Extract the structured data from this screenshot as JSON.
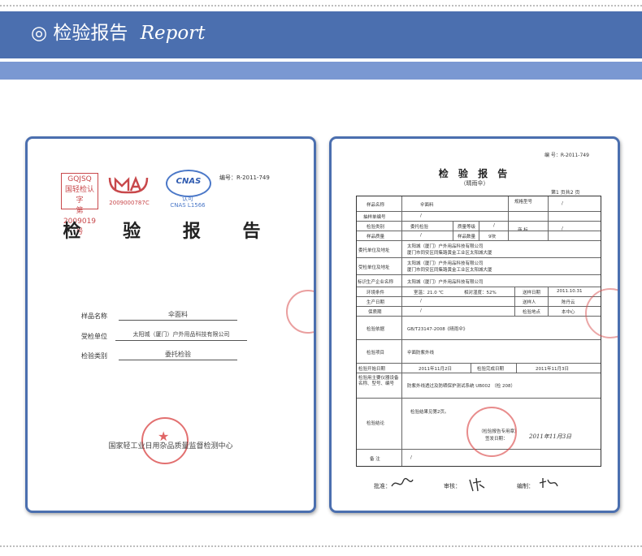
{
  "header": {
    "title": "检验报告",
    "title_script": "Report",
    "bullet_icon": "◎"
  },
  "cover": {
    "logo_gqjsq_top": "GQJSQ",
    "logo_gqjsq_mid": "国轻检认字",
    "logo_gqjsq_num": "第2009019号",
    "logo_ma_code": "2009000787C",
    "logo_cnas_label": "CNAS",
    "logo_cnas_cn": "认可",
    "logo_cnas_code": "CNAS L1566",
    "report_no_label": "编号：",
    "report_no": "R-2011-749",
    "title_left": "检 验",
    "title_right": "报 告",
    "fields": [
      {
        "label": "样品名称",
        "value": "伞面料"
      },
      {
        "label": "受检单位",
        "value": "太阳城（厦门）户外用品科技有限公司"
      },
      {
        "label": "检验类别",
        "value": "委托检验"
      }
    ],
    "org": "国家轻工业日用杂品质量监督检测中心"
  },
  "report": {
    "report_no_label": "编 号：",
    "report_no": "R-2011-749",
    "title": "检 验 报 告",
    "subtitle": "（晴雨伞）",
    "page": "第1 页共2 页",
    "rows": {
      "sample_name_label": "样品名称",
      "sample_name": "伞面料",
      "sample_no_label": "抽样单编号",
      "sample_no": "/",
      "model_label": "规格型号",
      "model": "/",
      "category_label": "检验类别",
      "category": "委托检验",
      "grade_label": "质量等级",
      "grade": "/",
      "brand_label": "商 标",
      "brand": "/",
      "qty_label": "样品数量",
      "qty": "9块",
      "quality_label": "样品质量",
      "quality": "/",
      "client_label": "委托单位及地址",
      "client": "太阳城（厦门）户外用品科技有限公司",
      "client_addr": "厦门市同安区同集路黄金工业区太阳城大厦",
      "inspected_label": "受检单位及地址",
      "inspected": "太阳城（厦门）户外用品科技有限公司",
      "inspected_addr": "厦门市同安区同集路黄金工业区太阳城大厦",
      "producer_label": "标识生产企业名称",
      "producer": "太阳城（厦门）户外用品科技有限公司",
      "env_label": "环境条件",
      "env_temp": "室温：21.0 ℃",
      "env_humidity": "相对湿度：52%",
      "send_date_label": "送样日期",
      "send_date": "2011.10.31",
      "prod_date_label": "生产日期",
      "prod_date": "/",
      "sender_label": "送样人",
      "sender": "陈丹云",
      "expire_label": "保质期",
      "expire": "/",
      "location_label": "检验地点",
      "location": "本中心",
      "basis_label": "检验依据",
      "basis": "GB/T23147-2008《晴雨伞》",
      "items_label": "检验项目",
      "items": "伞面防紫外线",
      "start_label": "检验开始日期",
      "start": "2011年11月2日",
      "end_label": "检验完成日期",
      "end": "2011年11月3日",
      "equip_label": "检验用主要仪器设备名称、型号、编号",
      "equip": "防紫外线透过及防晒保护测试系统 UB002 （检 208）",
      "conclusion_label": "检验结论",
      "conclusion": "检验结果见第2页。",
      "stamp_text": "（检验报告专用章）",
      "sign_date_label": "签发日期：",
      "sign_date": "2011年11月3日",
      "remark_label": "备 注",
      "remark": "/"
    },
    "approve_label": "批准：",
    "review_label": "审核：",
    "prepare_label": "编制："
  }
}
